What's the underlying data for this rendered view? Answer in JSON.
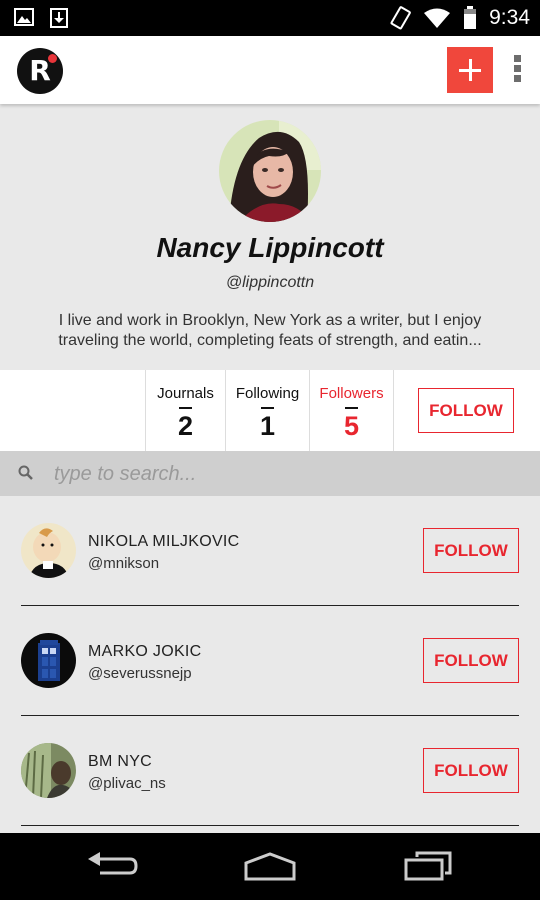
{
  "status_bar": {
    "time": "9:34"
  },
  "profile": {
    "name": "Nancy Lippincott",
    "handle": "@lippincottn",
    "bio": "I live and work in Brooklyn, New York as a writer, but I enjoy traveling the world, completing feats of strength, and eatin..."
  },
  "stats": [
    {
      "label": "Journals",
      "value": "2"
    },
    {
      "label": "Following",
      "value": "1"
    },
    {
      "label": "Followers",
      "value": "5"
    }
  ],
  "follow_label": "FOLLOW",
  "search": {
    "placeholder": "type to search..."
  },
  "users": [
    {
      "name": "NIKOLA MILJKOVIC",
      "handle": "@mnikson",
      "button": "FOLLOW"
    },
    {
      "name": "MARKO JOKIC",
      "handle": "@severussnejp",
      "button": "FOLLOW"
    },
    {
      "name": "BM NYC",
      "handle": "@plivac_ns",
      "button": "FOLLOW"
    }
  ],
  "colors": {
    "accent": "#e8262f",
    "add_button": "#f0473c",
    "logo_dot": "#e8353a"
  },
  "icons": [
    "image-icon",
    "download-icon",
    "vibrate-icon",
    "wifi-icon",
    "battery-icon",
    "logo-icon",
    "plus-icon",
    "overflow-menu-icon",
    "search-icon",
    "back-icon",
    "home-icon",
    "recents-icon"
  ]
}
